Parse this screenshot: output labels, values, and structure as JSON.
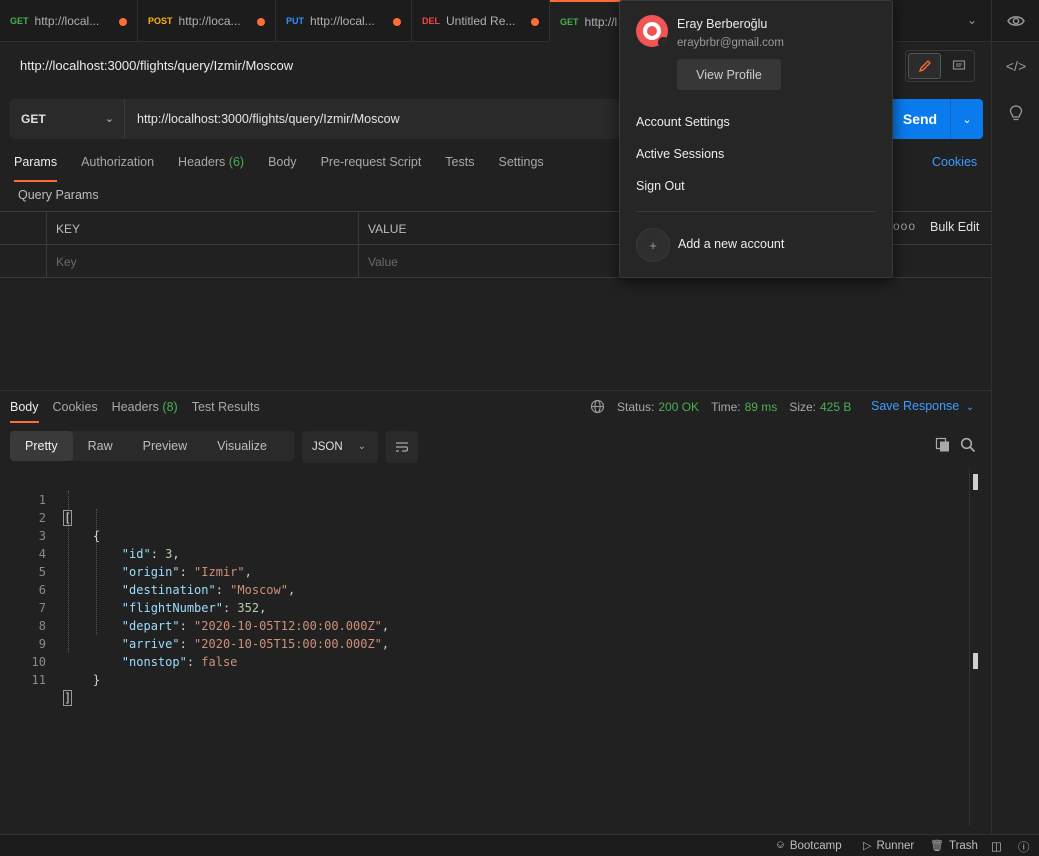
{
  "tabs": [
    {
      "method": "GET",
      "title": "http://local...",
      "unsaved": true
    },
    {
      "method": "POST",
      "title": "http://loca...",
      "unsaved": true
    },
    {
      "method": "PUT",
      "title": "http://local...",
      "unsaved": true
    },
    {
      "method": "DEL",
      "title": "Untitled Re...",
      "unsaved": true
    },
    {
      "method": "GET",
      "title": "http://l",
      "unsaved": false,
      "active": true
    }
  ],
  "request": {
    "title": "http://localhost:3000/flights/query/Izmir/Moscow",
    "method": "GET",
    "url": "http://localhost:3000/flights/query/Izmir/Moscow",
    "send_label": "Send"
  },
  "request_tabs": {
    "params": "Params",
    "authorization": "Authorization",
    "headers": "Headers",
    "headers_count": "(6)",
    "body": "Body",
    "prerequest": "Pre-request Script",
    "tests": "Tests",
    "settings": "Settings",
    "cookies": "Cookies"
  },
  "query_params": {
    "label": "Query Params",
    "col_key": "KEY",
    "col_value": "VALUE",
    "key_placeholder": "Key",
    "value_placeholder": "Value",
    "bulk_edit": "Bulk Edit",
    "more": "ooo"
  },
  "response_tabs": {
    "body": "Body",
    "cookies": "Cookies",
    "headers": "Headers",
    "headers_count": "(8)",
    "test_results": "Test Results"
  },
  "response_status": {
    "status_label": "Status:",
    "status_value": "200 OK",
    "time_label": "Time:",
    "time_value": "89 ms",
    "size_label": "Size:",
    "size_value": "425 B",
    "save_response": "Save Response"
  },
  "view_modes": {
    "pretty": "Pretty",
    "raw": "Raw",
    "preview": "Preview",
    "visualize": "Visualize",
    "format": "JSON"
  },
  "code_lines": [
    {
      "n": "1"
    },
    {
      "n": "2"
    },
    {
      "n": "3"
    },
    {
      "n": "4"
    },
    {
      "n": "5"
    },
    {
      "n": "6"
    },
    {
      "n": "7"
    },
    {
      "n": "8"
    },
    {
      "n": "9"
    },
    {
      "n": "10"
    },
    {
      "n": "11"
    }
  ],
  "json_body": {
    "open_bracket": "[",
    "open_brace": "{",
    "id_key": "\"id\"",
    "id_val": "3",
    "origin_key": "\"origin\"",
    "origin_val": "\"Izmir\"",
    "destination_key": "\"destination\"",
    "destination_val": "\"Moscow\"",
    "flight_key": "\"flightNumber\"",
    "flight_val": "352",
    "depart_key": "\"depart\"",
    "depart_val": "\"2020-10-05T12:00:00.000Z\"",
    "arrive_key": "\"arrive\"",
    "arrive_val": "\"2020-10-05T15:00:00.000Z\"",
    "nonstop_key": "\"nonstop\"",
    "nonstop_val": "false",
    "close_brace": "}",
    "close_bracket": "]"
  },
  "account": {
    "name": "Eray Berberoğlu",
    "email": "eraybrbr@gmail.com",
    "view_profile": "View Profile",
    "account_settings": "Account Settings",
    "active_sessions": "Active Sessions",
    "sign_out": "Sign Out",
    "add_account": "Add a new account"
  },
  "footer": {
    "bootcamp": "Bootcamp",
    "runner": "Runner",
    "trash": "Trash"
  },
  "colors": {
    "accent": "#ff6c37",
    "send": "#097bed",
    "link": "#3d9bff",
    "status_ok": "#4caf50",
    "avatar": "#f05454"
  }
}
